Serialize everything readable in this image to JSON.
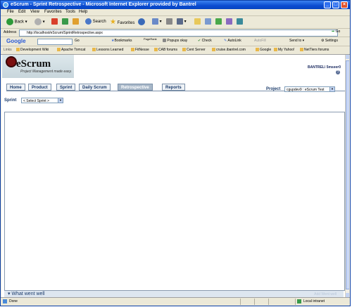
{
  "window": {
    "title": "eScrum - Sprint Retrospective - Microsoft Internet Explorer provided by Bantrel"
  },
  "menu": [
    "File",
    "Edit",
    "View",
    "Favorites",
    "Tools",
    "Help"
  ],
  "toolbar": {
    "back": "Back",
    "search": "Search",
    "favorites": "Favorites"
  },
  "address": {
    "label": "Address",
    "url": "http://localhost/eScrum/SprintRetrospective.aspx",
    "go": "Go",
    "links": "Links"
  },
  "google": {
    "logo": "Google",
    "go": "Go",
    "bookmarks": "Bookmarks",
    "pagerank": "PageRank",
    "popups": "Popups okay",
    "check": "Check",
    "autolink": "AutoLink",
    "autofill": "AutoFill",
    "sendto": "Send to",
    "settings": "Settings"
  },
  "links": [
    "Links",
    "Development Wiki",
    "Apache Tomcat",
    "Lessons Learned",
    "FitNesse",
    "CAB forums",
    "Cent Server",
    "cruise.ibantrel.com",
    "Google",
    "My Yahoo!",
    "NetTiers forums"
  ],
  "app": {
    "logo_name": "eScrum",
    "logo_tagline": "Project Management made easy.",
    "user": "BANTREL\\ 5mseer0",
    "help": "?",
    "tabs": [
      "Home",
      "Product",
      "Sprint",
      "Daily Scrum",
      "Retrospective",
      "Reports"
    ],
    "active_tab": "Retrospective",
    "project_label": "Project",
    "project_value": "cgupdev9 : eScrum Test",
    "sprint_label": "Sprint",
    "sprint_value": "< Select Sprint >",
    "section_title": "What went well",
    "section_add": "Add Went well"
  },
  "status": {
    "text": "Done",
    "zone": "Local intranet"
  },
  "colors": {
    "titlebar": "#0a4bd0",
    "accent": "#1a3a6a",
    "active_tab": "#a7b7c8"
  }
}
